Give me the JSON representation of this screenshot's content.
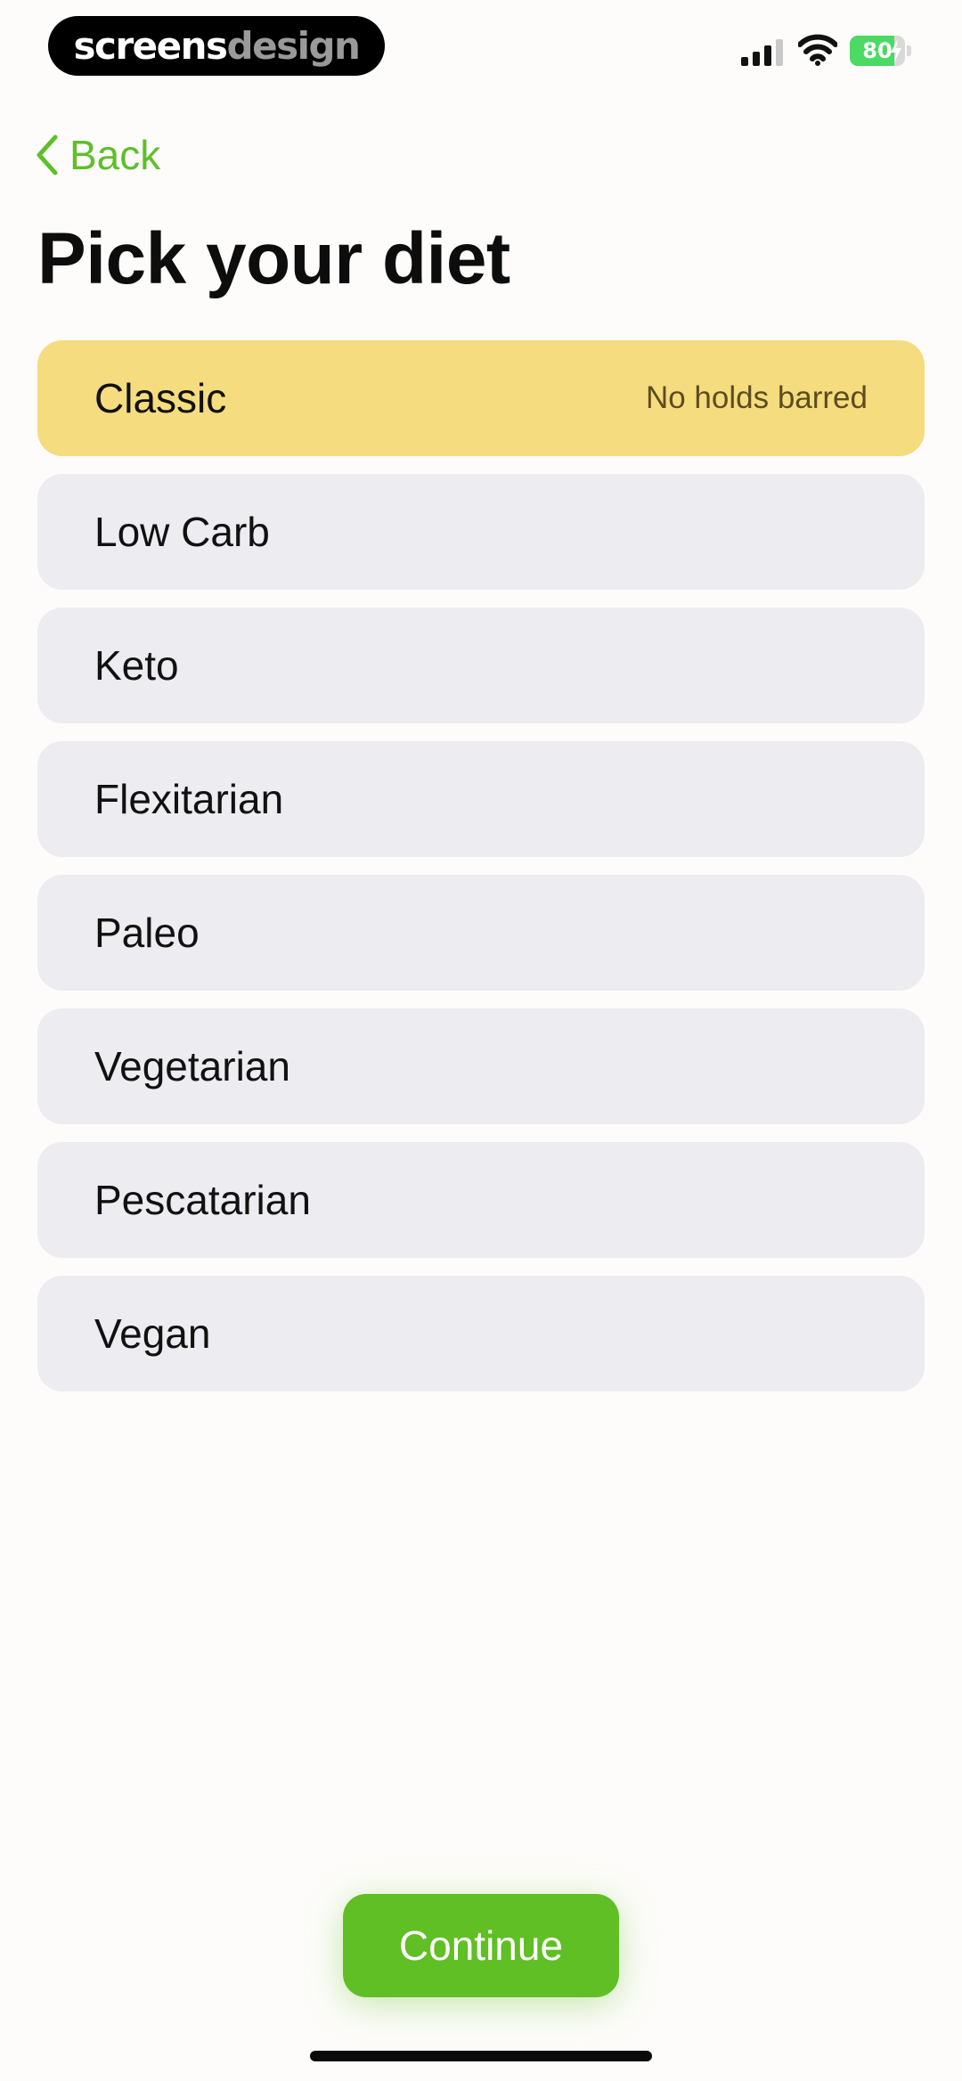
{
  "status_bar": {
    "brand_primary": "screens",
    "brand_secondary": "design",
    "battery_level": 80,
    "battery_label": "80",
    "icons": [
      "signal-icon",
      "wifi-icon",
      "battery-icon",
      "bolt-icon"
    ]
  },
  "nav": {
    "back_label": "Back",
    "back_icon": "chevron-left-icon"
  },
  "page_title": "Pick your diet",
  "diets": [
    {
      "name": "Classic",
      "description": "No holds barred",
      "selected": true
    },
    {
      "name": "Low Carb",
      "description": "",
      "selected": false
    },
    {
      "name": "Keto",
      "description": "",
      "selected": false
    },
    {
      "name": "Flexitarian",
      "description": "",
      "selected": false
    },
    {
      "name": "Paleo",
      "description": "",
      "selected": false
    },
    {
      "name": "Vegetarian",
      "description": "",
      "selected": false
    },
    {
      "name": "Pescatarian",
      "description": "",
      "selected": false
    },
    {
      "name": "Vegan",
      "description": "",
      "selected": false
    }
  ],
  "continue_label": "Continue",
  "colors": {
    "accent_green": "#60bf24",
    "selected_yellow": "#f5dc7e",
    "item_background": "#ececf1",
    "page_background": "#fdfcfa"
  }
}
